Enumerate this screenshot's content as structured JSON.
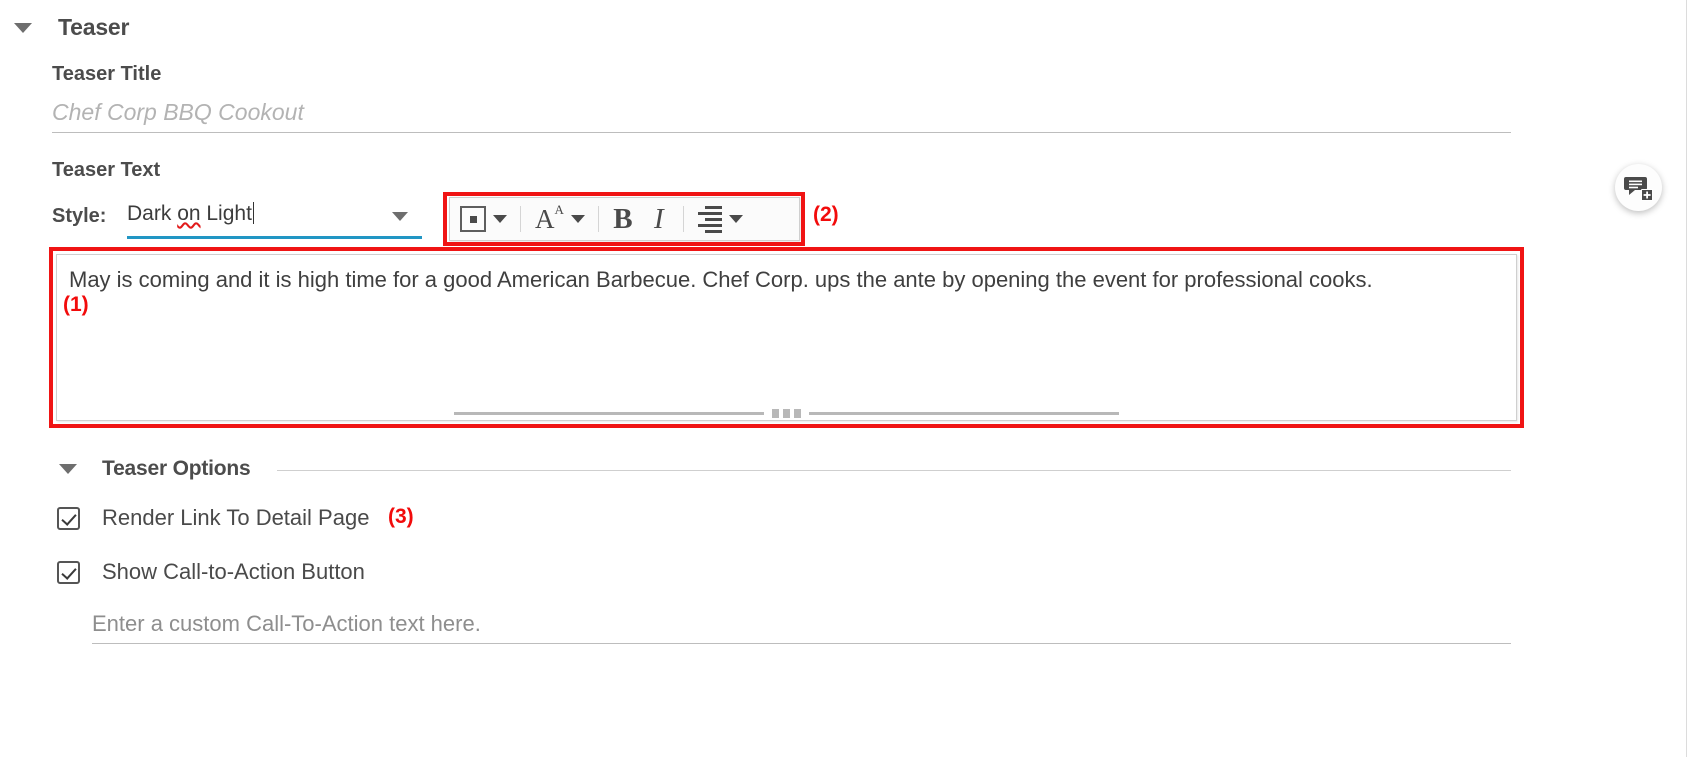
{
  "section": {
    "teaser_title_heading": "Teaser",
    "collapse_icon": "triangle-down-icon"
  },
  "fields": {
    "teaser_title_label": "Teaser Title",
    "teaser_title_value": "",
    "teaser_title_placeholder": "Chef Corp BBQ Cookout",
    "teaser_text_label": "Teaser Text"
  },
  "style_row": {
    "label": "Style:",
    "value_part1": "Dark ",
    "value_misspelled": "on",
    "value_part2": " Light",
    "full_value": "Dark on Light",
    "dropdown_icon": "chevron-down-icon",
    "focus_color": "#2196c4"
  },
  "toolbar": {
    "bullet_list_label": "bullet-list",
    "bullet_list_dropdown": "chevron-down-icon",
    "font_letter": "A",
    "font_superscript": "A",
    "font_dropdown": "chevron-down-icon",
    "bold_label": "B",
    "italic_label": "I",
    "align_label": "align",
    "align_dropdown": "chevron-down-icon"
  },
  "editor": {
    "text": "May is coming and it is high time for a good American Barbecue. Chef Corp. ups the ante by opening the event for professional cooks.",
    "resize_handle": "resize-grip"
  },
  "annotations": {
    "one": "(1)",
    "two": "(2)",
    "three": "(3)",
    "color": "#f20b0b"
  },
  "teaser_options": {
    "heading": "Teaser Options",
    "collapse_icon": "triangle-down-icon",
    "checkboxes": [
      {
        "label": "Render Link To Detail Page",
        "checked": true
      },
      {
        "label": "Show Call-to-Action Button",
        "checked": true
      }
    ],
    "cta_input_value": "",
    "cta_input_placeholder": "Enter a custom Call-To-Action text here."
  },
  "fab": {
    "name": "add-comment-button",
    "icon": "comment-plus-icon"
  }
}
